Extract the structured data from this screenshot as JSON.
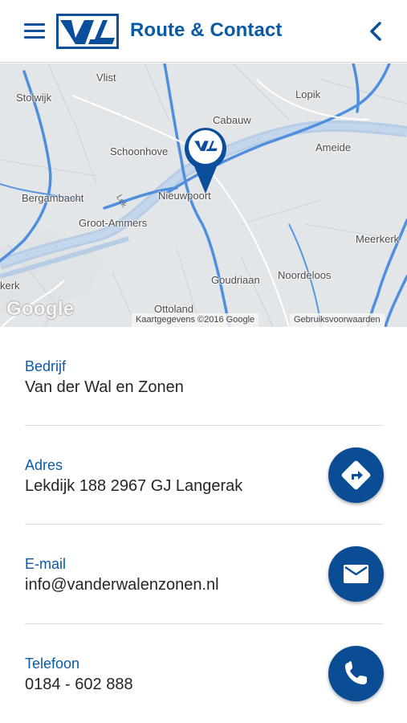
{
  "header": {
    "title": "Route & Contact",
    "menu_icon": "menu-icon",
    "back_icon": "chevron-left-icon",
    "logo": "company-logo",
    "accent_color": "#0b5aa8"
  },
  "map": {
    "places": {
      "vlist": "Vlist",
      "stolwijk": "Stolwijk",
      "lopik": "Lopik",
      "cabauw": "Cabauw",
      "schoonhoven": "Schoonhove",
      "ameide": "Ameide",
      "bergambacht": "Bergambacht",
      "nieuwpoort": "Nieuwpoort",
      "groot_ammers": "Groot-Ammers",
      "meerkerk": "Meerkerk",
      "kerk": "kerk",
      "goudriaan": "Goudriaan",
      "noordeloos": "Noordeloos",
      "ottoland": "Ottoland"
    },
    "road_label": "Lek",
    "google_logo": "Google",
    "map_data": "Kaartgegevens ©2016 Google",
    "terms": "Gebruiksvoorwaarden"
  },
  "info": {
    "company": {
      "label": "Bedrijf",
      "value": "Van der Wal en Zonen"
    },
    "address": {
      "label": "Adres",
      "value": "Lekdijk 188 2967 GJ Langerak",
      "action_icon": "directions-icon"
    },
    "email": {
      "label": "E-mail",
      "value": "info@vanderwalenzonen.nl",
      "action_icon": "mail-icon"
    },
    "phone": {
      "label": "Telefoon",
      "value": "0184 - 602 888",
      "action_icon": "phone-icon"
    }
  }
}
